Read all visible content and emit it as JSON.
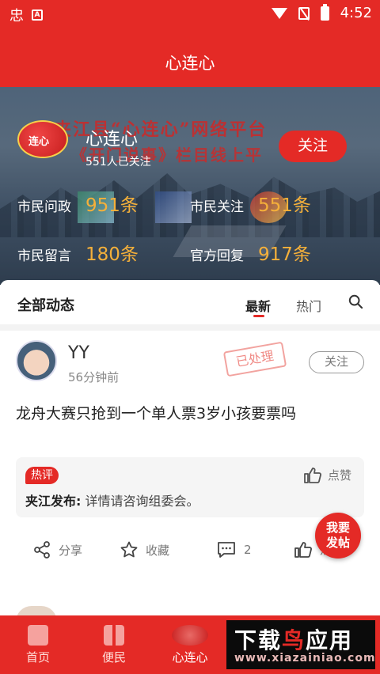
{
  "status_bar": {
    "time": "4:52",
    "left_icon_glyph": "忠"
  },
  "header": {
    "title": "心连心"
  },
  "hero": {
    "banner_line1": "夹江县“心连心”网络平台",
    "banner_line2": "《开门说事》栏目线上平",
    "logo_text": "连心",
    "channel_name": "心连心",
    "followers": "551人已关注",
    "follow_label": "关注",
    "stats": [
      {
        "label": "市民问政",
        "value": "951条"
      },
      {
        "label": "市民关注",
        "value": "551条"
      },
      {
        "label": "市民留言",
        "value": "180条"
      },
      {
        "label": "官方回复",
        "value": "917条"
      }
    ]
  },
  "feed": {
    "title": "全部动态",
    "tabs": [
      "最新",
      "热门"
    ],
    "active_tab": "最新"
  },
  "post": {
    "author": "YY",
    "time": "56分钟前",
    "stamp": "已处理",
    "follow_label": "关注",
    "text": "龙舟大赛只抢到一个单人票3岁小孩要票吗",
    "comment": {
      "tag": "热评",
      "like_label": "点赞",
      "author": "夹江发布:",
      "text": "详情请咨询组委会。"
    },
    "actions": {
      "share": "分享",
      "favorite": "收藏",
      "comments": "2",
      "like": "点赞"
    }
  },
  "fab": {
    "line1": "我要",
    "line2": "发帖"
  },
  "bottom_nav": [
    {
      "label": "首页"
    },
    {
      "label": "便民"
    },
    {
      "label": "心连心"
    }
  ],
  "watermark": {
    "line1a": "下载",
    "line1b": "鸟",
    "line1c": "应用",
    "line2": "www.xiazainiao.com"
  },
  "colors": {
    "brand_red": "#e42a26",
    "stat_orange": "#f5b03a"
  }
}
